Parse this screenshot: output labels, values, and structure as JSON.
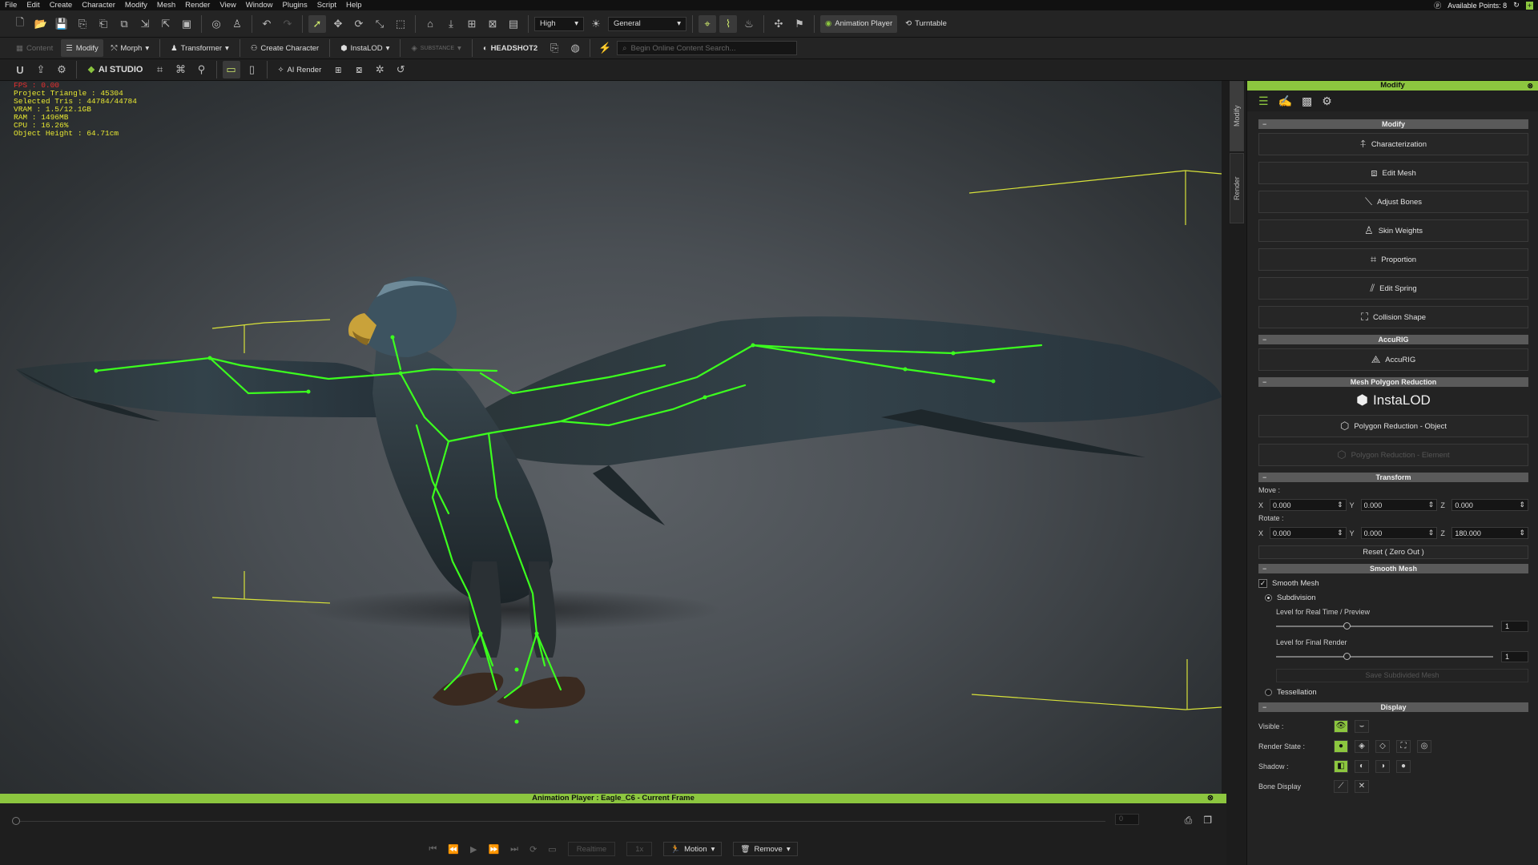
{
  "menu": [
    "File",
    "Edit",
    "Create",
    "Character",
    "Modify",
    "Mesh",
    "Render",
    "View",
    "Window",
    "Plugins",
    "Script",
    "Help"
  ],
  "account": {
    "points": "Available Points: 8"
  },
  "toolbar1": {
    "quality": "High",
    "mode": "General",
    "animation_player": "Animation Player",
    "turntable": "Turntable"
  },
  "toolbar2": {
    "content": "Content",
    "modify": "Modify",
    "morph": "Morph",
    "transformer": "Transformer",
    "create_character": "Create Character",
    "instalod": "InstaLOD",
    "substance": "SUBSTANCE",
    "headshot": "HEADSHOT2",
    "search_placeholder": "Begin Online Content Search..."
  },
  "toolbar3": {
    "ai_studio": "AI STUDIO",
    "ai_render": "AI Render"
  },
  "stats": {
    "fps": "FPS : 0.00",
    "project_triangle": "Project Triangle : 45304",
    "selected_tris": "Selected Tris : 44784/44784",
    "vram": "VRAM : 1.5/12.1GB",
    "ram": "RAM : 1496MB",
    "cpu": "CPU : 16.26%",
    "object_height": "Object Height : 64.71cm"
  },
  "side_tabs": [
    "Modify",
    "Render"
  ],
  "panel": {
    "title": "Modify",
    "sections": {
      "modify": "Modify",
      "accurig": "AccuRIG",
      "mesh_reduction": "Mesh Polygon Reduction",
      "transform": "Transform",
      "smooth_mesh": "Smooth Mesh",
      "display": "Display"
    },
    "modify_buttons": [
      "Characterization",
      "Edit Mesh",
      "Adjust Bones",
      "Skin Weights",
      "Proportion",
      "Edit Spring",
      "Collision Shape"
    ],
    "accurig_button": "AccuRIG",
    "instalod_logo": "InstaLOD",
    "reduction_object": "Polygon Reduction - Object",
    "reduction_element": "Polygon Reduction - Element",
    "transform": {
      "move_label": "Move :",
      "rotate_label": "Rotate :",
      "move": {
        "x": "0.000",
        "y": "0.000",
        "z": "0.000"
      },
      "rotate": {
        "x": "0.000",
        "y": "0.000",
        "z": "180.000"
      },
      "reset": "Reset ( Zero Out )"
    },
    "smooth": {
      "smooth_mesh": "Smooth Mesh",
      "subdivision": "Subdivision",
      "realtime_label": "Level for Real Time / Preview",
      "realtime_value": "1",
      "final_label": "Level for Final Render",
      "final_value": "1",
      "save_btn": "Save Subdivided Mesh",
      "tessellation": "Tessellation"
    },
    "display": {
      "visible": "Visible :",
      "render_state": "Render State :",
      "shadow": "Shadow :",
      "bone_display": "Bone Display"
    }
  },
  "animation": {
    "title": "Animation Player : Eagle_C6 - Current Frame",
    "frame": "0",
    "realtime": "Realtime",
    "speed": "1x",
    "motion": "Motion",
    "remove": "Remove"
  },
  "colors": {
    "accent": "#8cc63f",
    "bone": "#3cff1e",
    "bbox": "#d8e23a"
  }
}
